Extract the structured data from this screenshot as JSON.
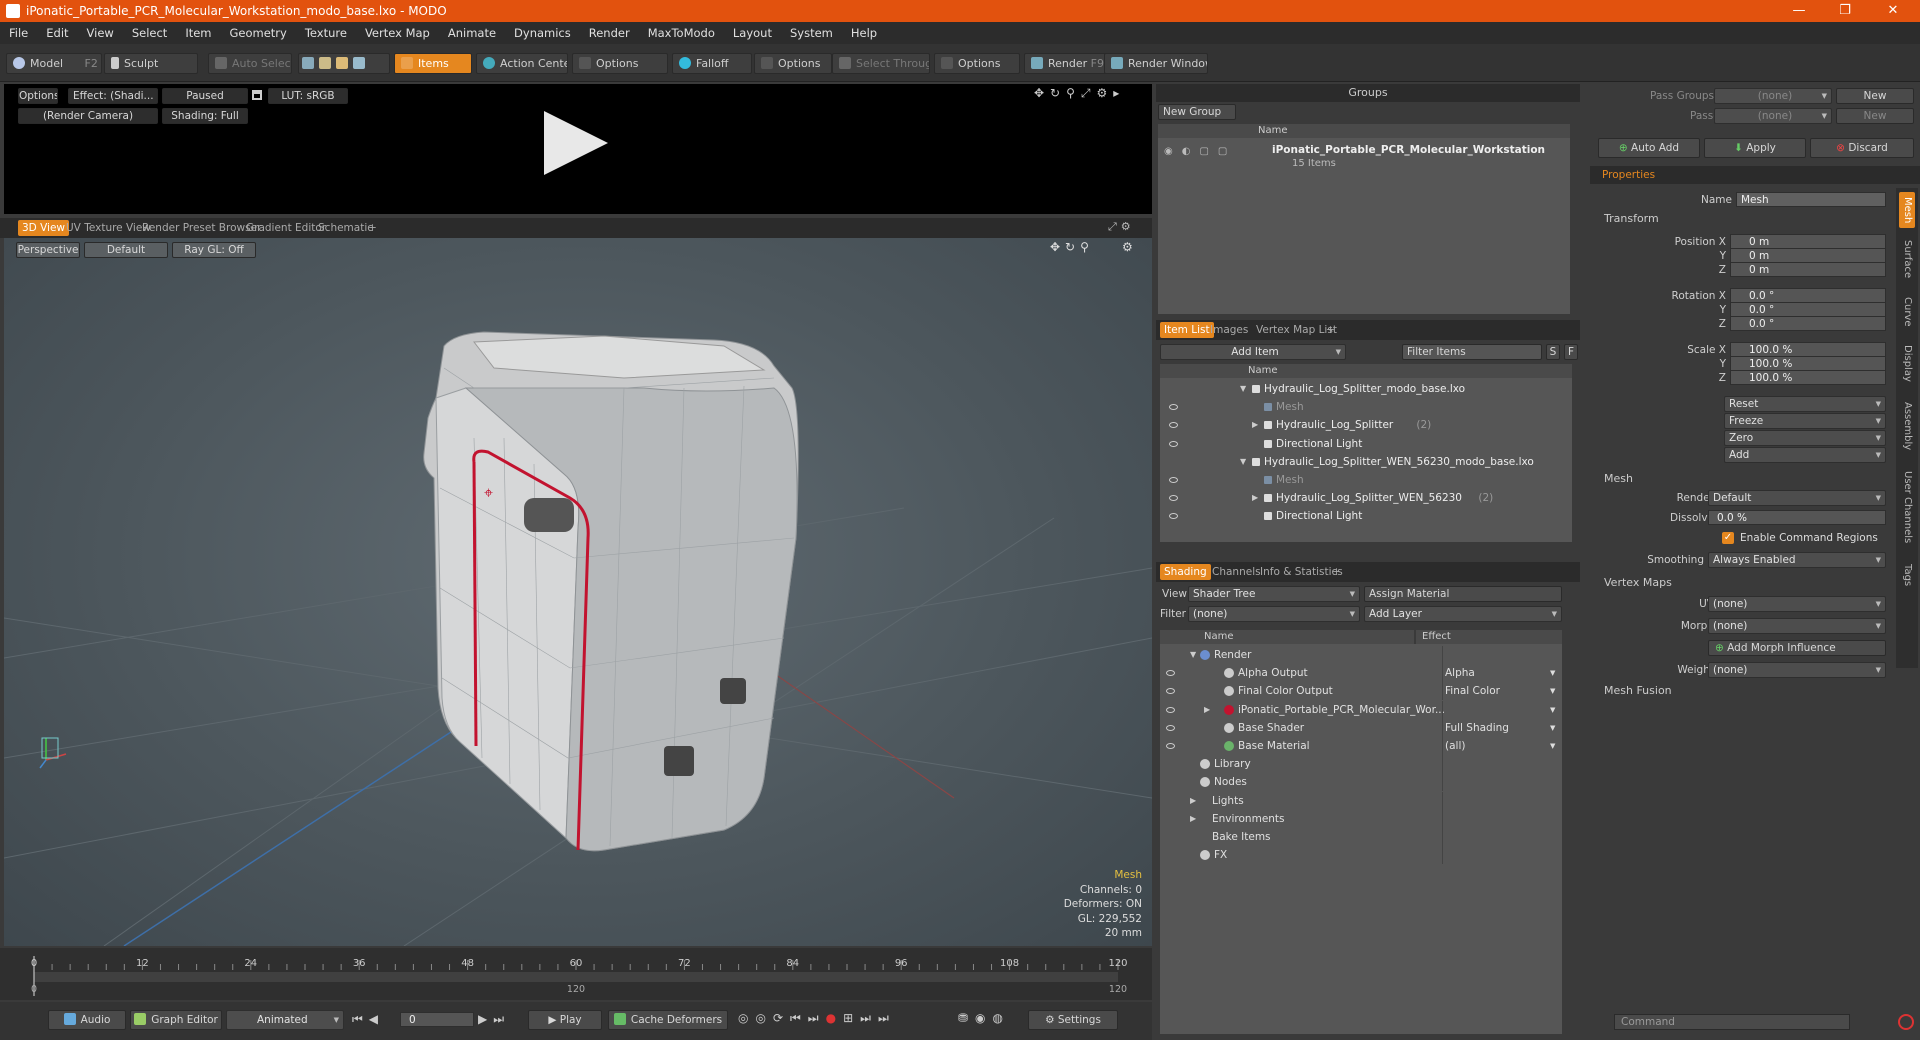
{
  "window": {
    "title": "iPonatic_Portable_PCR_Molecular_Workstation_modo_base.lxo - MODO",
    "minimize": "—",
    "maximize": "❐",
    "close": "✕"
  },
  "menu": [
    "File",
    "Edit",
    "View",
    "Select",
    "Item",
    "Geometry",
    "Texture",
    "Vertex Map",
    "Animate",
    "Dynamics",
    "Render",
    "MaxToModo",
    "Layout",
    "System",
    "Help"
  ],
  "toolbar": {
    "model": "Model",
    "model_key": "F2",
    "sculpt": "Sculpt",
    "auto_select": "Auto Select",
    "items": "Items",
    "action_center": "Action Center",
    "options1": "Options",
    "falloff": "Falloff",
    "options2": "Options",
    "select_through": "Select Through",
    "options3": "Options",
    "render": "Render",
    "render_key": "F9",
    "render_window": "Render Window"
  },
  "preview": {
    "options": "Options",
    "effect": "Effect: (Shadi...",
    "paused": "Paused",
    "lut": "LUT: sRGB",
    "camera": "(Render Camera)",
    "shading": "Shading: Full"
  },
  "viewport_tabs": [
    "3D View",
    "UV Texture View",
    "Render Preset Browser",
    "Gradient Editor",
    "Schematic",
    "+"
  ],
  "viewport": {
    "perspective": "Perspective",
    "default": "Default",
    "raygl": "Ray GL: Off",
    "info_title": "Mesh",
    "info": [
      "Channels: 0",
      "Deformers: ON",
      "GL: 229,552",
      "20 mm"
    ]
  },
  "timeline": {
    "ticks": [
      "0",
      "12",
      "24",
      "36",
      "48",
      "60",
      "72",
      "84",
      "96",
      "108",
      "120"
    ],
    "sub_left": "0",
    "sub_mid": "120",
    "sub_right": "120"
  },
  "transport": {
    "audio": "Audio",
    "graph_editor": "Graph Editor",
    "animated": "Animated",
    "frame": "0",
    "play": "Play",
    "cache": "Cache Deformers",
    "settings": "Settings"
  },
  "groups": {
    "title": "Groups",
    "new_group": "New Group",
    "col_name": "Name",
    "item": "iPonatic_Portable_PCR_Molecular_Workstation",
    "count": "15 Items"
  },
  "itemlist": {
    "tabs": [
      "Item List",
      "Images",
      "Vertex Map List",
      "+"
    ],
    "add_item": "Add Item",
    "filter": "Filter Items",
    "s": "S",
    "f": "F",
    "col_name": "Name",
    "rows": [
      {
        "indent": 0,
        "arrow": "▼",
        "text": "Hydraulic_Log_Splitter_modo_base.lxo",
        "dim": false,
        "eye": false
      },
      {
        "indent": 1,
        "arrow": "",
        "text": "Mesh",
        "dim": true,
        "eye": true
      },
      {
        "indent": 1,
        "arrow": "▶",
        "text": "Hydraulic_Log_Splitter",
        "suffix": "(2)",
        "dim": false,
        "eye": true
      },
      {
        "indent": 1,
        "arrow": "",
        "text": "Directional Light",
        "dim": false,
        "eye": true
      },
      {
        "indent": 0,
        "arrow": "▼",
        "text": "Hydraulic_Log_Splitter_WEN_56230_modo_base.lxo",
        "dim": false,
        "eye": false
      },
      {
        "indent": 1,
        "arrow": "",
        "text": "Mesh",
        "dim": true,
        "eye": true
      },
      {
        "indent": 1,
        "arrow": "▶",
        "text": "Hydraulic_Log_Splitter_WEN_56230",
        "suffix": "(2)",
        "dim": false,
        "eye": true
      },
      {
        "indent": 1,
        "arrow": "",
        "text": "Directional Light",
        "dim": false,
        "eye": true
      }
    ]
  },
  "shading": {
    "tabs": [
      "Shading",
      "Channels",
      "Info & Statistics",
      "+"
    ],
    "view_label": "View",
    "view": "Shader Tree",
    "assign": "Assign Material",
    "filter_label": "Filter",
    "filter": "(none)",
    "add_layer": "Add Layer",
    "col_name": "Name",
    "col_effect": "Effect",
    "rows": [
      {
        "indent": 0,
        "arrow": "▼",
        "text": "Render",
        "effect": "",
        "eye": false
      },
      {
        "indent": 1,
        "arrow": "",
        "text": "Alpha Output",
        "effect": "Alpha",
        "eye": true
      },
      {
        "indent": 1,
        "arrow": "",
        "text": "Final Color Output",
        "effect": "Final Color",
        "eye": true
      },
      {
        "indent": 1,
        "arrow": "▶",
        "text": "iPonatic_Portable_PCR_Molecular_Wor...",
        "effect": "",
        "eye": true
      },
      {
        "indent": 1,
        "arrow": "",
        "text": "Base Shader",
        "effect": "Full Shading",
        "eye": true
      },
      {
        "indent": 1,
        "arrow": "",
        "text": "Base Material",
        "effect": "(all)",
        "eye": true
      },
      {
        "indent": 0,
        "arrow": "",
        "text": "Library",
        "effect": "",
        "eye": false
      },
      {
        "indent": 0,
        "arrow": "",
        "text": "Nodes",
        "effect": "",
        "eye": false
      },
      {
        "indent": -1,
        "arrow": "▶",
        "text": "Lights",
        "effect": "",
        "eye": false
      },
      {
        "indent": -1,
        "arrow": "▶",
        "text": "Environments",
        "effect": "",
        "eye": false
      },
      {
        "indent": -1,
        "arrow": "",
        "text": "Bake Items",
        "effect": "",
        "eye": false
      },
      {
        "indent": 0,
        "arrow": "",
        "text": "FX",
        "effect": "",
        "eye": false
      }
    ]
  },
  "props": {
    "pass_groups": "Pass Groups",
    "passes": "Passes",
    "none": "(none)",
    "new": "New",
    "auto_add": "Auto Add",
    "apply": "Apply",
    "discard": "Discard",
    "tab": "Properties",
    "name_label": "Name",
    "name_value": "Mesh",
    "transform": "Transform",
    "position": "Position X",
    "rotation": "Rotation X",
    "scale": "Scale X",
    "y": "Y",
    "z": "Z",
    "pos": [
      "0 m",
      "0 m",
      "0 m"
    ],
    "rot": [
      "0.0 °",
      "0.0 °",
      "0.0 °"
    ],
    "scl": [
      "100.0 %",
      "100.0 %",
      "100.0 %"
    ],
    "reset": "Reset",
    "freeze": "Freeze",
    "zero": "Zero",
    "add": "Add",
    "mesh": "Mesh",
    "render_label": "Render",
    "render_value": "Default",
    "dissolve_label": "Dissolve",
    "dissolve_value": "0.0 %",
    "enable_cmd": "Enable Command Regions",
    "smoothing_label": "Smoothing",
    "smoothing_value": "Always Enabled",
    "vertex_maps": "Vertex Maps",
    "uv_label": "UV",
    "uv_value": "(none)",
    "morph_label": "Morph",
    "morph_value": "(none)",
    "add_morph": "Add Morph Influence",
    "weight_label": "Weight",
    "weight_value": "(none)",
    "mesh_fusion": "Mesh Fusion",
    "side_tabs": [
      "Mesh",
      "Surface",
      "Curve",
      "Display",
      "Assembly",
      "User Channels",
      "Tags"
    ],
    "command": "Command"
  },
  "colors": {
    "accent": "#e5871f",
    "title": "#e2520e",
    "pcr_red": "#c2132f"
  }
}
